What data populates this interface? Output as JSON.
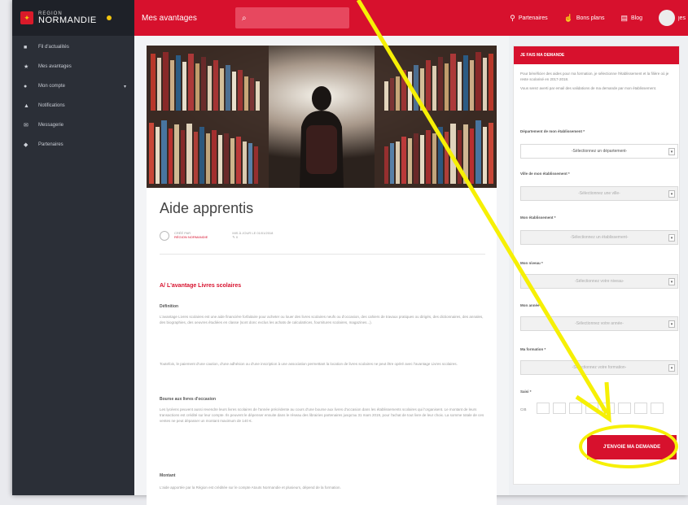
{
  "brand": {
    "region_small": "RÉGION",
    "region_big": "NORMANDIE"
  },
  "sidebar": {
    "items": [
      {
        "label": "Fil d'actualités",
        "icon": "home-icon"
      },
      {
        "label": "Mes avantages",
        "icon": "star-icon"
      },
      {
        "label": "Mon compte",
        "icon": "user-icon",
        "has_chevron": true
      },
      {
        "label": "Notifications",
        "icon": "bell-icon"
      },
      {
        "label": "Messagerie",
        "icon": "envelope-icon"
      },
      {
        "label": "Partenaires",
        "icon": "pin-icon"
      }
    ]
  },
  "topbar": {
    "page_title": "Mes avantages",
    "search_icon": "search-icon",
    "links": [
      {
        "label": "Partenaires",
        "icon": "map-pin-icon"
      },
      {
        "label": "Bons plans",
        "icon": "thumbs-up-icon"
      },
      {
        "label": "Blog",
        "icon": "newspaper-icon"
      }
    ],
    "user_short": "jes"
  },
  "article": {
    "title": "Aide apprentis",
    "meta_author_label": "CRÉÉ PAR",
    "meta_author": "RÉGION NORMANDIE",
    "meta_date": "MIS À JOUR LE 01/01/2018",
    "meta_comments": "0",
    "section_title": "A/ L'avantage Livres scolaires",
    "sub1": "Définition",
    "para1": "L'avantage Livres scolaires est une aide financière forfaitaire pour acheter ou louer des livres scolaires neufs ou d'occasion, des cahiers de travaux pratiques ou dirigés, des dictionnaires, des annales, des biographies, des oeuvres étudiées en classe (sont donc exclus les achats de calculatrices, fournitures scolaires, magazines...).",
    "para2": "Toutefois, le paiement d'une caution, d'une adhésion ou d'une inscription à une association permettant la location de livres scolaires ne peut être opéré avec l'avantage Livres scolaires.",
    "sub2": "Bourse aux livres d'occasion",
    "para3": "Les lycéens peuvent aussi revendre leurs livres scolaires de l'année précédente au cours d'une bourse aux livres d'occasion dans les établissements scolaires qui l'organisent. Le montant de leurs transactions est crédité sur leur compte. Ils peuvent le dépenser ensuite dans le réseau des librairies partenaires jusqu'au 31 mars 2019, pour l'achat de tout livre de leur choix. La somme totale de ces ventes ne peut dépasser un montant maximum de 140 €.",
    "sub3": "Montant",
    "para4": "L'aide apportée par la Région est créditée sur le compte Atouts Normandie et plusieurs, dépend de la formation."
  },
  "form": {
    "header": "JE FAIS MA DEMANDE",
    "intro1": "Pour bénéficier des aides pour ma formation, je sélectionne l'établissement et la filière où je reste scolarisé en 2017-2018.",
    "intro2": "Vous serez averti par email des validations de ma demande par mon établissement.",
    "fields": [
      {
        "label": "Département de mon établissement *",
        "placeholder": "-Sélectionnez un département-",
        "disabled": false
      },
      {
        "label": "Ville de mon établissement *",
        "placeholder": "-Sélectionnez une ville-",
        "disabled": true
      },
      {
        "label": "Mon établissement *",
        "placeholder": "-Sélectionnez un établissement-",
        "disabled": true
      },
      {
        "label": "Mon niveau *",
        "placeholder": "-Sélectionnez votre niveau-",
        "disabled": true
      },
      {
        "label": "Mon année *",
        "placeholder": "-Sélectionnez votre année-",
        "disabled": true
      },
      {
        "label": "Ma formation *",
        "placeholder": "-Sélectionnez votre formation-",
        "disabled": true
      }
    ],
    "date_label": "Saisi *",
    "date_prefix": "CIB",
    "submit_label": "J'ENVOIE MA DEMANDE"
  },
  "colors": {
    "accent": "#d7112d",
    "sidebar": "#2b2f37",
    "highlight": "#f6f005"
  }
}
